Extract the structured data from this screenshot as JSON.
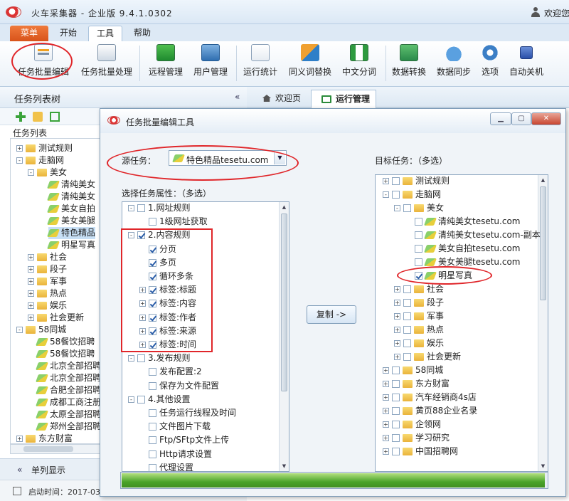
{
  "app": {
    "title": "火车采集器 - 企业版 9.4.1.0302",
    "welcome": "欢迎您"
  },
  "menu": {
    "menu_button": "菜单",
    "tabs": [
      "开始",
      "工具",
      "帮助"
    ]
  },
  "ribbon": {
    "buttons": [
      "任务批量编辑",
      "任务批量处理",
      "远程管理",
      "用户管理",
      "运行统计",
      "同义词替换",
      "中文分词",
      "数据转换",
      "数据同步",
      "选项",
      "自动关机"
    ]
  },
  "left_panel": {
    "title": "任务列表树",
    "list_label": "任务列表",
    "tree": [
      {
        "label": "测试规则",
        "level": 0,
        "kind": "folder",
        "pm": "+"
      },
      {
        "label": "走脑网",
        "level": 0,
        "kind": "folder",
        "pm": "-"
      },
      {
        "label": "美女",
        "level": 1,
        "kind": "folder",
        "pm": "-"
      },
      {
        "label": "清纯美女",
        "level": 2,
        "kind": "task"
      },
      {
        "label": "清纯美女",
        "level": 2,
        "kind": "task"
      },
      {
        "label": "美女自拍",
        "level": 2,
        "kind": "task"
      },
      {
        "label": "美女美腿",
        "level": 2,
        "kind": "task"
      },
      {
        "label": "特色精品",
        "level": 2,
        "kind": "task",
        "selected": true
      },
      {
        "label": "明星写真",
        "level": 2,
        "kind": "task"
      },
      {
        "label": "社会",
        "level": 1,
        "kind": "folder",
        "pm": "+"
      },
      {
        "label": "段子",
        "level": 1,
        "kind": "folder",
        "pm": "+"
      },
      {
        "label": "军事",
        "level": 1,
        "kind": "folder",
        "pm": "+"
      },
      {
        "label": "热点",
        "level": 1,
        "kind": "folder",
        "pm": "+"
      },
      {
        "label": "娱乐",
        "level": 1,
        "kind": "folder",
        "pm": "+"
      },
      {
        "label": "社会更新",
        "level": 1,
        "kind": "folder",
        "pm": "+"
      },
      {
        "label": "58同城",
        "level": 0,
        "kind": "folder",
        "pm": "-"
      },
      {
        "label": "58餐饮招聘",
        "level": 1,
        "kind": "task"
      },
      {
        "label": "58餐饮招聘",
        "level": 1,
        "kind": "task"
      },
      {
        "label": "北京全部招聘",
        "level": 1,
        "kind": "task"
      },
      {
        "label": "北京全部招聘",
        "level": 1,
        "kind": "task"
      },
      {
        "label": "合肥全部招聘",
        "level": 1,
        "kind": "task"
      },
      {
        "label": "成都工商注册",
        "level": 1,
        "kind": "task"
      },
      {
        "label": "太原全部招聘",
        "level": 1,
        "kind": "task"
      },
      {
        "label": "郑州全部招聘",
        "level": 1,
        "kind": "task"
      },
      {
        "label": "东方财富",
        "level": 0,
        "kind": "folder",
        "pm": "+"
      }
    ],
    "single_column": "单列显示",
    "status": "启动时间：2017-03"
  },
  "doc_tabs": [
    "欢迎页",
    "运行管理"
  ],
  "dialog": {
    "title": "任务批量编辑工具",
    "source_label": "源任务：",
    "source_value": "特色精品tesetu.com",
    "attr_label": "选择任务属性：（多选）",
    "attr_tree": [
      {
        "label": "1.网址规则",
        "level": 0,
        "pm": "-",
        "checked": false
      },
      {
        "label": "1级网址获取",
        "level": 1,
        "checked": false
      },
      {
        "label": "2.内容规则",
        "level": 0,
        "pm": "-",
        "checked": true
      },
      {
        "label": "分页",
        "level": 1,
        "checked": true
      },
      {
        "label": "多页",
        "level": 1,
        "checked": true
      },
      {
        "label": "循环多条",
        "level": 1,
        "checked": true
      },
      {
        "label": "标签:标题",
        "level": 1,
        "pm": "+",
        "checked": true
      },
      {
        "label": "标签:内容",
        "level": 1,
        "pm": "+",
        "checked": true
      },
      {
        "label": "标签:作者",
        "level": 1,
        "pm": "+",
        "checked": true
      },
      {
        "label": "标签:来源",
        "level": 1,
        "pm": "+",
        "checked": true
      },
      {
        "label": "标签:时间",
        "level": 1,
        "pm": "+",
        "checked": true
      },
      {
        "label": "3.发布规则",
        "level": 0,
        "pm": "-",
        "checked": false
      },
      {
        "label": "发布配置:2",
        "level": 1,
        "checked": false
      },
      {
        "label": "保存为文件配置",
        "level": 1,
        "checked": false
      },
      {
        "label": "4.其他设置",
        "level": 0,
        "pm": "-",
        "checked": false
      },
      {
        "label": "任务运行线程及时间",
        "level": 1,
        "checked": false
      },
      {
        "label": "文件图片下载",
        "level": 1,
        "checked": false
      },
      {
        "label": "Ftp/SFtp文件上传",
        "level": 1,
        "checked": false
      },
      {
        "label": "Http请求设置",
        "level": 1,
        "checked": false
      },
      {
        "label": "代理设置",
        "level": 1,
        "checked": false
      }
    ],
    "copy_button": "复制 ->",
    "target_label": "目标任务：（多选）",
    "target_tree": [
      {
        "label": "测试规则",
        "level": 0,
        "kind": "folder",
        "pm": "+",
        "checked": false
      },
      {
        "label": "走脑网",
        "level": 0,
        "kind": "folder",
        "pm": "-",
        "checked": false
      },
      {
        "label": "美女",
        "level": 1,
        "kind": "folder",
        "pm": "-",
        "checked": false
      },
      {
        "label": "清纯美女tesetu.com",
        "level": 2,
        "kind": "task",
        "checked": false
      },
      {
        "label": "清纯美女tesetu.com-副本",
        "level": 2,
        "kind": "task",
        "checked": false
      },
      {
        "label": "美女自拍tesetu.com",
        "level": 2,
        "kind": "task",
        "checked": false
      },
      {
        "label": "美女美腿tesetu.com",
        "level": 2,
        "kind": "task",
        "checked": false
      },
      {
        "label": "明星写真",
        "level": 2,
        "kind": "task",
        "checked": true
      },
      {
        "label": "社会",
        "level": 1,
        "kind": "folder",
        "pm": "+",
        "checked": false
      },
      {
        "label": "段子",
        "level": 1,
        "kind": "folder",
        "pm": "+",
        "checked": false
      },
      {
        "label": "军事",
        "level": 1,
        "kind": "folder",
        "pm": "+",
        "checked": false
      },
      {
        "label": "热点",
        "level": 1,
        "kind": "folder",
        "pm": "+",
        "checked": false
      },
      {
        "label": "娱乐",
        "level": 1,
        "kind": "folder",
        "pm": "+",
        "checked": false
      },
      {
        "label": "社会更新",
        "level": 1,
        "kind": "folder",
        "pm": "+",
        "checked": false
      },
      {
        "label": "58同城",
        "level": 0,
        "kind": "folder",
        "pm": "+",
        "checked": false
      },
      {
        "label": "东方财富",
        "level": 0,
        "kind": "folder",
        "pm": "+",
        "checked": false
      },
      {
        "label": "汽车经销商4s店",
        "level": 0,
        "kind": "folder",
        "pm": "+",
        "checked": false
      },
      {
        "label": "黄页88企业名录",
        "level": 0,
        "kind": "folder",
        "pm": "+",
        "checked": false
      },
      {
        "label": "企领网",
        "level": 0,
        "kind": "folder",
        "pm": "+",
        "checked": false
      },
      {
        "label": "学习研究",
        "level": 0,
        "kind": "folder",
        "pm": "+",
        "checked": false
      },
      {
        "label": "中国招聘网",
        "level": 0,
        "kind": "folder",
        "pm": "+",
        "checked": false
      }
    ],
    "progress": 0.995
  },
  "colors": {
    "accent": "#d8531a",
    "highlight": "#e0262a",
    "progress": "#4aa42a",
    "selection": "#c7dff5"
  }
}
